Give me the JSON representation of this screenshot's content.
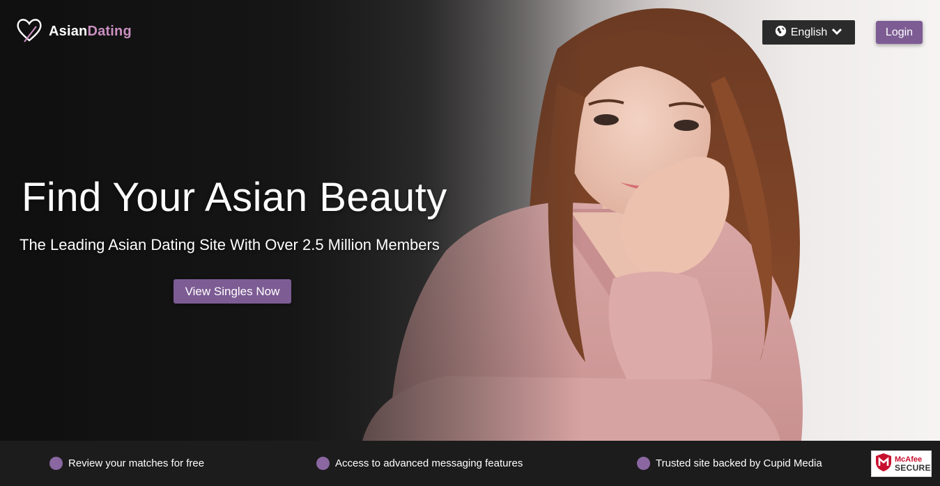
{
  "brand": {
    "logo_part1": "Asian",
    "logo_part2": "Dating",
    "accent_color": "#c98fc0",
    "primary_color": "#7d5c94"
  },
  "header": {
    "language": "English",
    "language_icon": "globe-icon",
    "dropdown_icon": "chevron-down-icon",
    "login_label": "Login"
  },
  "hero": {
    "headline": "Find Your Asian Beauty",
    "subheadline": "The Leading Asian Dating Site With Over 2.5 Million Members",
    "cta_label": "View Singles Now"
  },
  "features": [
    {
      "label": "Review your matches for free"
    },
    {
      "label": "Access to advanced messaging features"
    },
    {
      "label": "Trusted site backed by Cupid Media"
    }
  ],
  "badge": {
    "brand": "McAfee",
    "tagline": "SECURE"
  }
}
